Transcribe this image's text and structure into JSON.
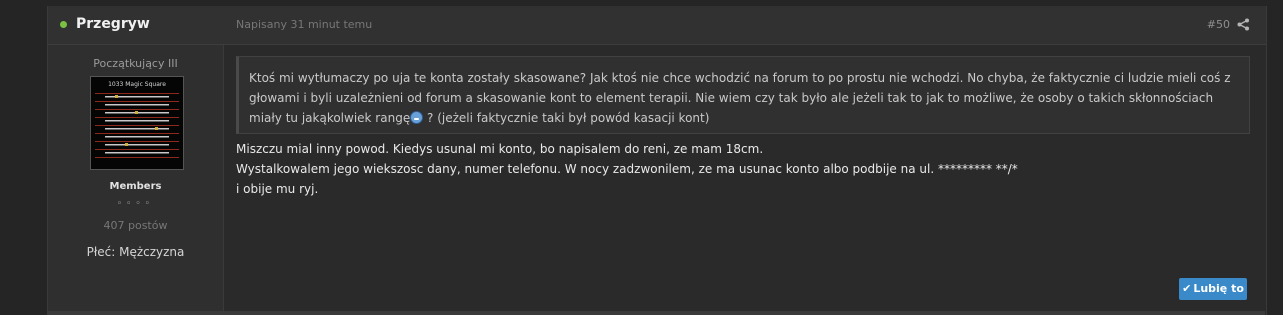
{
  "post": {
    "author": "Przegryw",
    "date": "Napisany 31 minut temu",
    "number": "#50",
    "colors": {
      "online": "#7ac143",
      "like_button": "#3a8ac9"
    }
  },
  "author_info": {
    "rank": "Początkujący III",
    "avatar_caption": "1033 Magic Square",
    "group": "Members",
    "pips": "◦◦◦◦",
    "post_count": "407 postów",
    "gender": "Płeć: Mężczyzna"
  },
  "quote": {
    "text": "Ktoś mi wytłumaczy po uja te konta zostały skasowane? Jak ktoś nie chce wchodzić na forum to po prostu nie wchodzi. No chyba, że faktycznie ci ludzie mieli coś z głowami i byli uzależnieni od forum a skasowanie kont to element terapii. Nie wiem czy tak było ale jeżeli tak to jak to możliwe, że osoby o takich skłonnościach miały tu jakąkolwiek rangę",
    "text_after_emoji": " ? (jeżeli faktycznie taki był powód kasacji kont)",
    "emoji_icon": "laughing-emoji-icon"
  },
  "body": {
    "line1": "Miszczu mial inny powod. Kiedys usunal mi konto, bo napisalem do reni, ze mam 18cm.",
    "line2": "Wystalkowalem jego wiekszosc dany, numer telefonu. W nocy zadzwonilem, ze ma usunac konto albo podbije na ul. ********* **/*",
    "line3": "i obije mu ryj."
  },
  "actions": {
    "like_label": "Lubię to",
    "like_icon": "check-icon",
    "share_icon": "share-icon"
  }
}
